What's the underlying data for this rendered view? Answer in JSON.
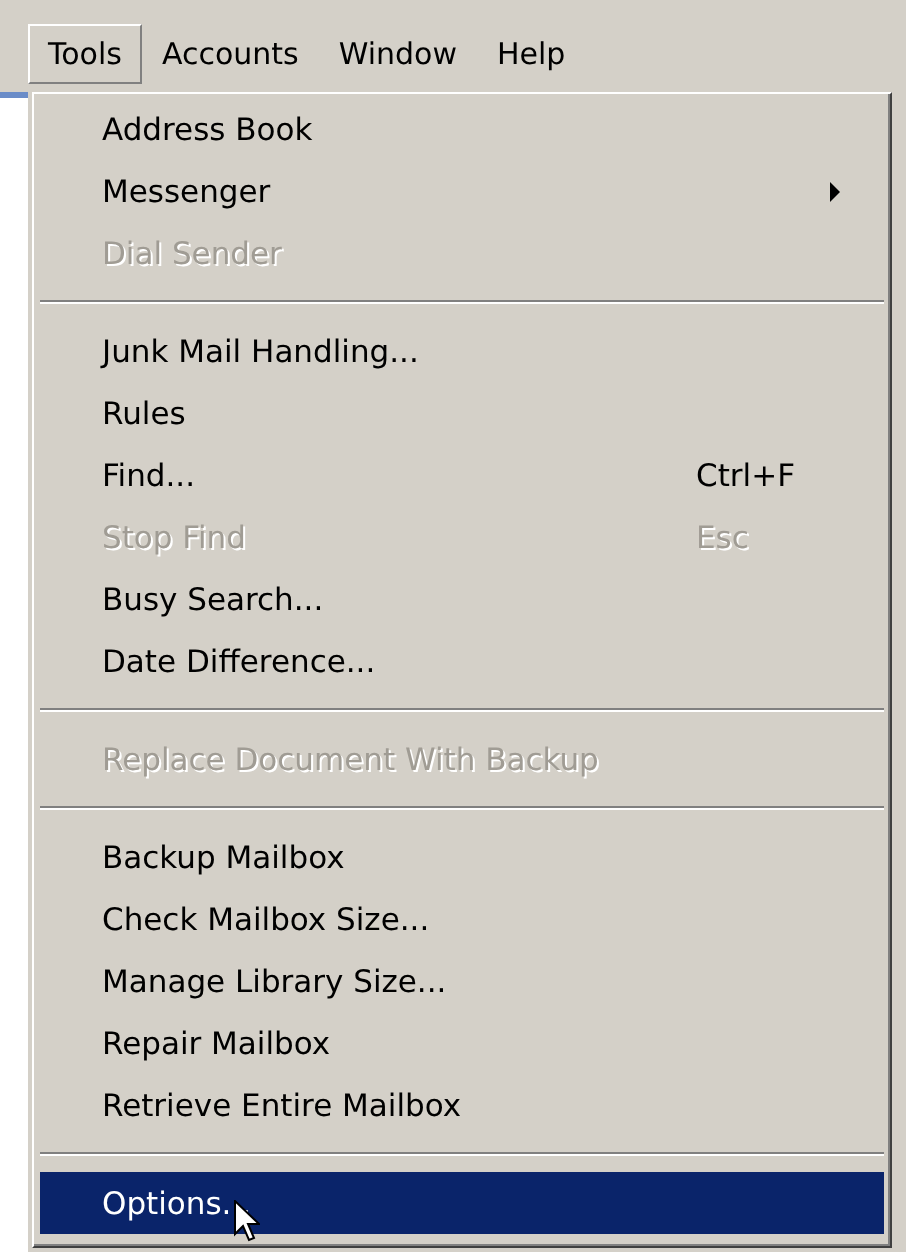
{
  "menubar": [
    {
      "label": "Tools",
      "selected": true
    },
    {
      "label": "Accounts",
      "selected": false
    },
    {
      "label": "Window",
      "selected": false
    },
    {
      "label": "Help",
      "selected": false
    }
  ],
  "menu": {
    "items": [
      {
        "kind": "item",
        "label": "Address Book",
        "disabled": false,
        "submenu": false,
        "selected": false
      },
      {
        "kind": "item",
        "label": "Messenger",
        "disabled": false,
        "submenu": true,
        "selected": false
      },
      {
        "kind": "item",
        "label": "Dial Sender",
        "disabled": true,
        "submenu": false,
        "selected": false
      },
      {
        "kind": "separator"
      },
      {
        "kind": "item",
        "label": "Junk Mail Handling...",
        "disabled": false,
        "submenu": false,
        "selected": false
      },
      {
        "kind": "item",
        "label": "Rules",
        "disabled": false,
        "submenu": false,
        "selected": false
      },
      {
        "kind": "item",
        "label": "Find...",
        "shortcut": "Ctrl+F",
        "disabled": false,
        "submenu": false,
        "selected": false
      },
      {
        "kind": "item",
        "label": "Stop Find",
        "shortcut": "Esc",
        "disabled": true,
        "submenu": false,
        "selected": false
      },
      {
        "kind": "item",
        "label": "Busy Search...",
        "disabled": false,
        "submenu": false,
        "selected": false
      },
      {
        "kind": "item",
        "label": "Date Difference...",
        "disabled": false,
        "submenu": false,
        "selected": false
      },
      {
        "kind": "separator"
      },
      {
        "kind": "item",
        "label": "Replace Document With Backup",
        "disabled": true,
        "submenu": false,
        "selected": false
      },
      {
        "kind": "separator"
      },
      {
        "kind": "item",
        "label": "Backup Mailbox",
        "disabled": false,
        "submenu": false,
        "selected": false
      },
      {
        "kind": "item",
        "label": "Check Mailbox Size...",
        "disabled": false,
        "submenu": false,
        "selected": false
      },
      {
        "kind": "item",
        "label": "Manage Library Size...",
        "disabled": false,
        "submenu": false,
        "selected": false
      },
      {
        "kind": "item",
        "label": "Repair Mailbox",
        "disabled": false,
        "submenu": false,
        "selected": false
      },
      {
        "kind": "item",
        "label": "Retrieve Entire Mailbox",
        "disabled": false,
        "submenu": false,
        "selected": false
      },
      {
        "kind": "separator"
      },
      {
        "kind": "item",
        "label": "Options...",
        "disabled": false,
        "submenu": false,
        "selected": true
      }
    ]
  }
}
